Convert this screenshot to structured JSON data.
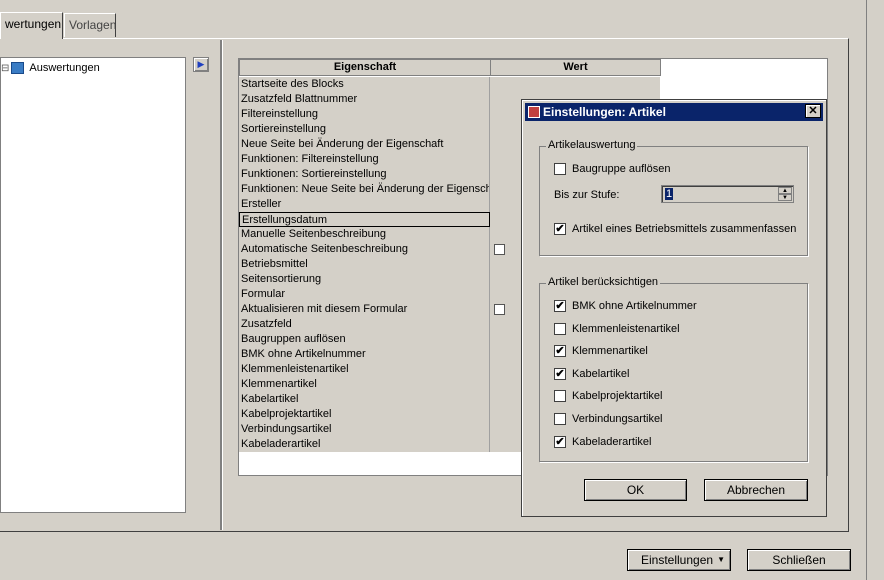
{
  "tabs": [
    {
      "label": "wertungen"
    },
    {
      "label": "Vorlagen"
    }
  ],
  "tree": {
    "expander": "⊟",
    "root_label": "Auswertungen"
  },
  "grid": {
    "columns": {
      "name": "Eigenschaft",
      "value": "Wert"
    },
    "rows": [
      {
        "label": "Startseite des Blocks",
        "checkbox": false
      },
      {
        "label": "Zusatzfeld Blattnummer",
        "checkbox": false
      },
      {
        "label": "Filtereinstellung",
        "checkbox": false
      },
      {
        "label": "Sortiereinstellung",
        "checkbox": false
      },
      {
        "label": "Neue Seite bei Änderung der Eigenschaft",
        "checkbox": false
      },
      {
        "label": "Funktionen: Filtereinstellung",
        "checkbox": false
      },
      {
        "label": "Funktionen: Sortiereinstellung",
        "checkbox": false
      },
      {
        "label": "Funktionen: Neue Seite bei Änderung der Eigensch",
        "checkbox": false
      },
      {
        "label": "Ersteller",
        "checkbox": false
      },
      {
        "label": "Erstellungsdatum",
        "checkbox": false,
        "selected": true
      },
      {
        "label": "Manuelle Seitenbeschreibung",
        "checkbox": false
      },
      {
        "label": "Automatische Seitenbeschreibung",
        "checkbox": true
      },
      {
        "label": "Betriebsmittel",
        "checkbox": false
      },
      {
        "label": "Seitensortierung",
        "checkbox": false
      },
      {
        "label": "Formular",
        "checkbox": false
      },
      {
        "label": "Aktualisieren mit diesem Formular",
        "checkbox": true
      },
      {
        "label": "Zusatzfeld",
        "checkbox": false
      },
      {
        "label": "Baugruppen auflösen",
        "checkbox": false
      },
      {
        "label": "BMK ohne Artikelnummer",
        "checkbox": false
      },
      {
        "label": "Klemmenleistenartikel",
        "checkbox": false
      },
      {
        "label": "Klemmenartikel",
        "checkbox": false
      },
      {
        "label": "Kabelartikel",
        "checkbox": false
      },
      {
        "label": "Kabelprojektartikel",
        "checkbox": false
      },
      {
        "label": "Verbindungsartikel",
        "checkbox": false
      },
      {
        "label": "Kabeladerartikel",
        "checkbox": false
      }
    ]
  },
  "dialog": {
    "title": "Einstellungen: Artikel",
    "group1": {
      "label": "Artikelauswertung",
      "baugruppe": {
        "label": "Baugruppe auflösen",
        "checked": false
      },
      "stufe_label": "Bis zur Stufe:",
      "stufe_value": "1",
      "zusammenfassen": {
        "label": "Artikel eines Betriebsmittels zusammenfassen",
        "checked": true
      }
    },
    "group2": {
      "label": "Artikel berücksichtigen",
      "items": [
        {
          "label": "BMK ohne Artikelnummer",
          "checked": true
        },
        {
          "label": "Klemmenleistenartikel",
          "checked": false
        },
        {
          "label": "Klemmenartikel",
          "checked": true
        },
        {
          "label": "Kabelartikel",
          "checked": true
        },
        {
          "label": "Kabelprojektartikel",
          "checked": false
        },
        {
          "label": "Verbindungsartikel",
          "checked": false
        },
        {
          "label": "Kabeladerartikel",
          "checked": true
        }
      ]
    },
    "ok_label": "OK",
    "cancel_label": "Abbrechen",
    "check_glyph": "✔"
  },
  "footer": {
    "settings_label": "Einstellungen",
    "dropdown_glyph": "▼",
    "close_label": "Schließen"
  }
}
